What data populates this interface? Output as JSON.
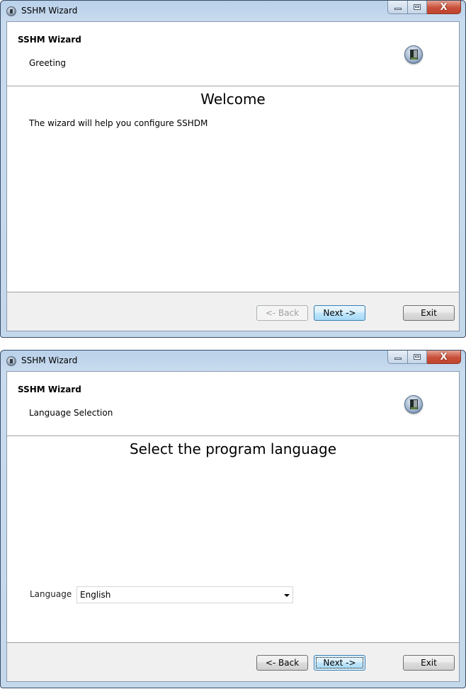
{
  "windows": [
    {
      "title": "SSHM Wizard",
      "header": {
        "title": "SSHM Wizard",
        "subtitle": "Greeting"
      },
      "page": {
        "heading": "Welcome",
        "text": "The wizard will help you configure SSHDM"
      },
      "buttons": {
        "back": "<- Back",
        "next": "Next ->",
        "exit": "Exit"
      },
      "back_enabled": false
    },
    {
      "title": "SSHM Wizard",
      "header": {
        "title": "SSHM Wizard",
        "subtitle": "Language Selection"
      },
      "page": {
        "heading": "Select the program language",
        "language_label": "Language",
        "language_value": "English"
      },
      "buttons": {
        "back": "<- Back",
        "next": "Next ->",
        "exit": "Exit"
      },
      "back_enabled": true
    }
  ],
  "caption_buttons": {
    "minimize_icon": "minimize-icon",
    "maximize_icon": "maximize-icon",
    "close_glyph": "X"
  }
}
